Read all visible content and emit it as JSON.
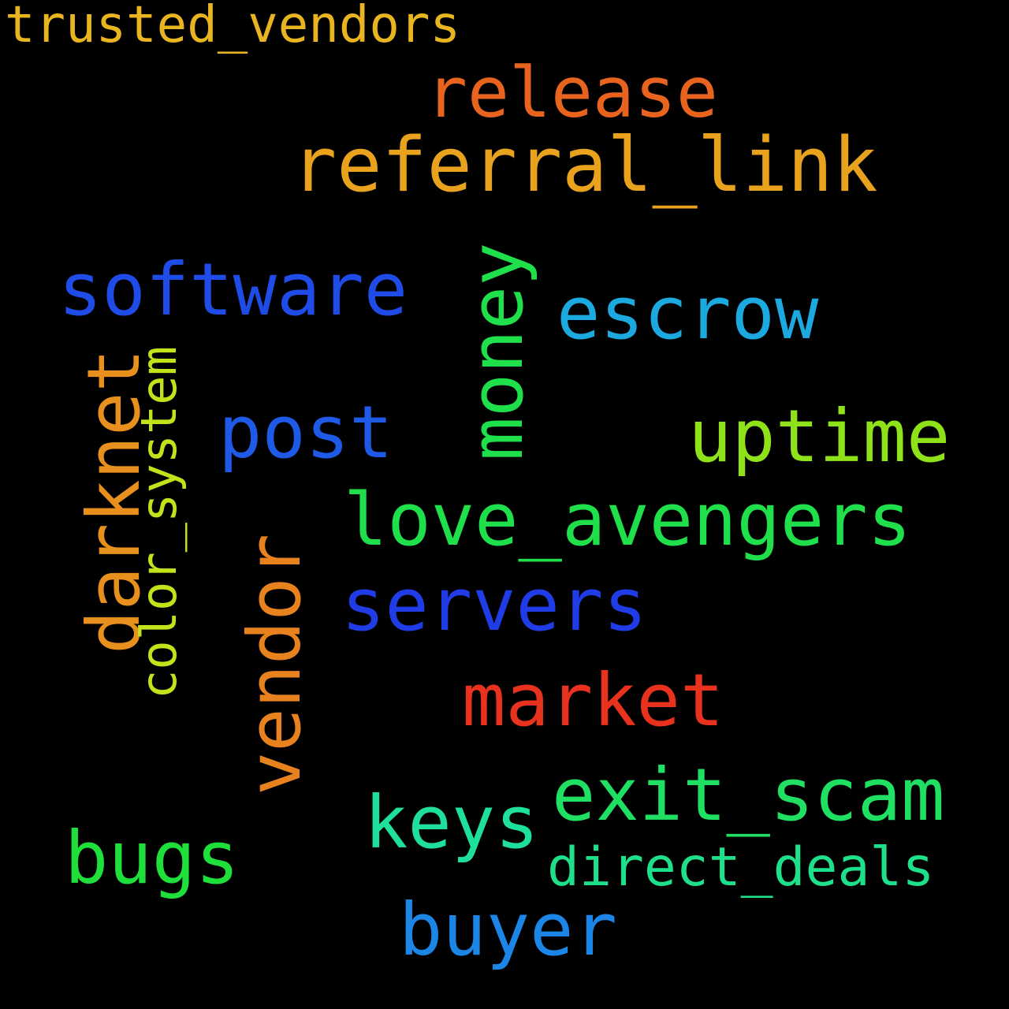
{
  "words": {
    "trusted_vendors": {
      "text": "trusted_vendors",
      "color": "#e8b420"
    },
    "release": {
      "text": "release",
      "color": "#e8641e"
    },
    "referral_link": {
      "text": "referral_link",
      "color": "#e8a21e"
    },
    "software": {
      "text": "software",
      "color": "#1f4be6"
    },
    "money": {
      "text": "money",
      "color": "#1fe04a"
    },
    "escrow": {
      "text": "escrow",
      "color": "#1ca9e0"
    },
    "darknet": {
      "text": "darknet",
      "color": "#e8901e"
    },
    "color_system": {
      "text": "color_system",
      "color": "#c2e21a"
    },
    "post": {
      "text": "post",
      "color": "#1f5ae6"
    },
    "uptime": {
      "text": "uptime",
      "color": "#8fe21a"
    },
    "love_avengers": {
      "text": "love_avengers",
      "color": "#1fe04a"
    },
    "vendor": {
      "text": "vendor",
      "color": "#e8821e"
    },
    "servers": {
      "text": "servers",
      "color": "#1f3ce6"
    },
    "market": {
      "text": "market",
      "color": "#e8321e"
    },
    "exit_scam": {
      "text": "exit_scam",
      "color": "#1fe062"
    },
    "keys": {
      "text": "keys",
      "color": "#1fe09a"
    },
    "direct_deals": {
      "text": "direct_deals",
      "color": "#1fe08a"
    },
    "bugs": {
      "text": "bugs",
      "color": "#1fe03a"
    },
    "buyer": {
      "text": "buyer",
      "color": "#1c86e6"
    }
  }
}
